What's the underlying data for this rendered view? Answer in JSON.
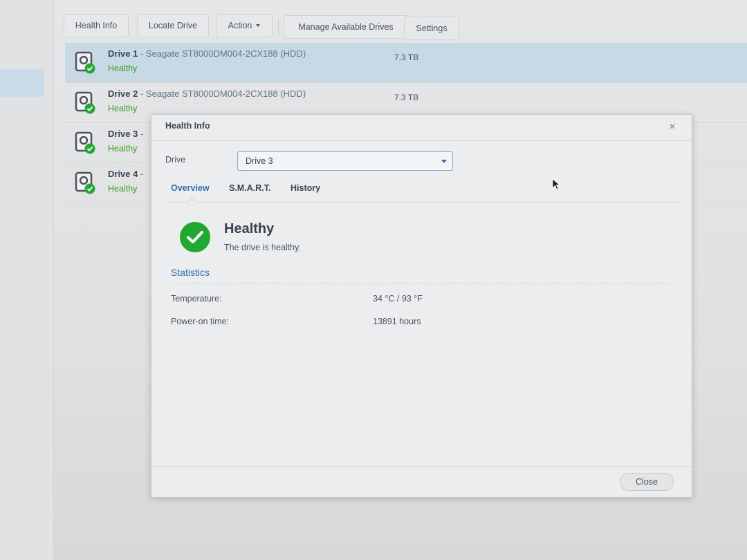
{
  "toolbar": {
    "health_info": "Health Info",
    "locate_drive": "Locate Drive",
    "action": "Action",
    "manage_drives": "Manage Available Drives",
    "settings": "Settings"
  },
  "drives": [
    {
      "name": "Drive 1",
      "model": " - Seagate ST8000DM004-2CX188 (HDD)",
      "status": "Healthy",
      "size": "7.3 TB"
    },
    {
      "name": "Drive 2",
      "model": " - Seagate ST8000DM004-2CX188 (HDD)",
      "status": "Healthy",
      "size": "7.3 TB"
    },
    {
      "name": "Drive 3",
      "model": " -",
      "status": "Healthy",
      "size": ""
    },
    {
      "name": "Drive 4",
      "model": " -",
      "status": "Healthy",
      "size": ""
    }
  ],
  "dialog": {
    "title": "Health Info",
    "close_icon": "×",
    "drive_label": "Drive",
    "drive_selected": "Drive 3",
    "tabs": [
      "Overview",
      "S.M.A.R.T.",
      "History"
    ],
    "health_title": "Healthy",
    "health_desc": "The drive is healthy.",
    "stats_title": "Statistics",
    "temperature_label": "Temperature:",
    "temperature_value": "34 °C / 93 °F",
    "power_on_label": "Power-on time:",
    "power_on_value": "13891 hours",
    "close_button": "Close"
  },
  "colors": {
    "accent": "#2f6fbd",
    "healthy_green": "#3a9a2a",
    "check_green": "#1faa2f",
    "selected_row": "#c8d9e6"
  },
  "icons": [
    "drive-health-icon",
    "chevron-down-icon",
    "close-icon",
    "check-circle-icon",
    "mouse-cursor-icon"
  ]
}
